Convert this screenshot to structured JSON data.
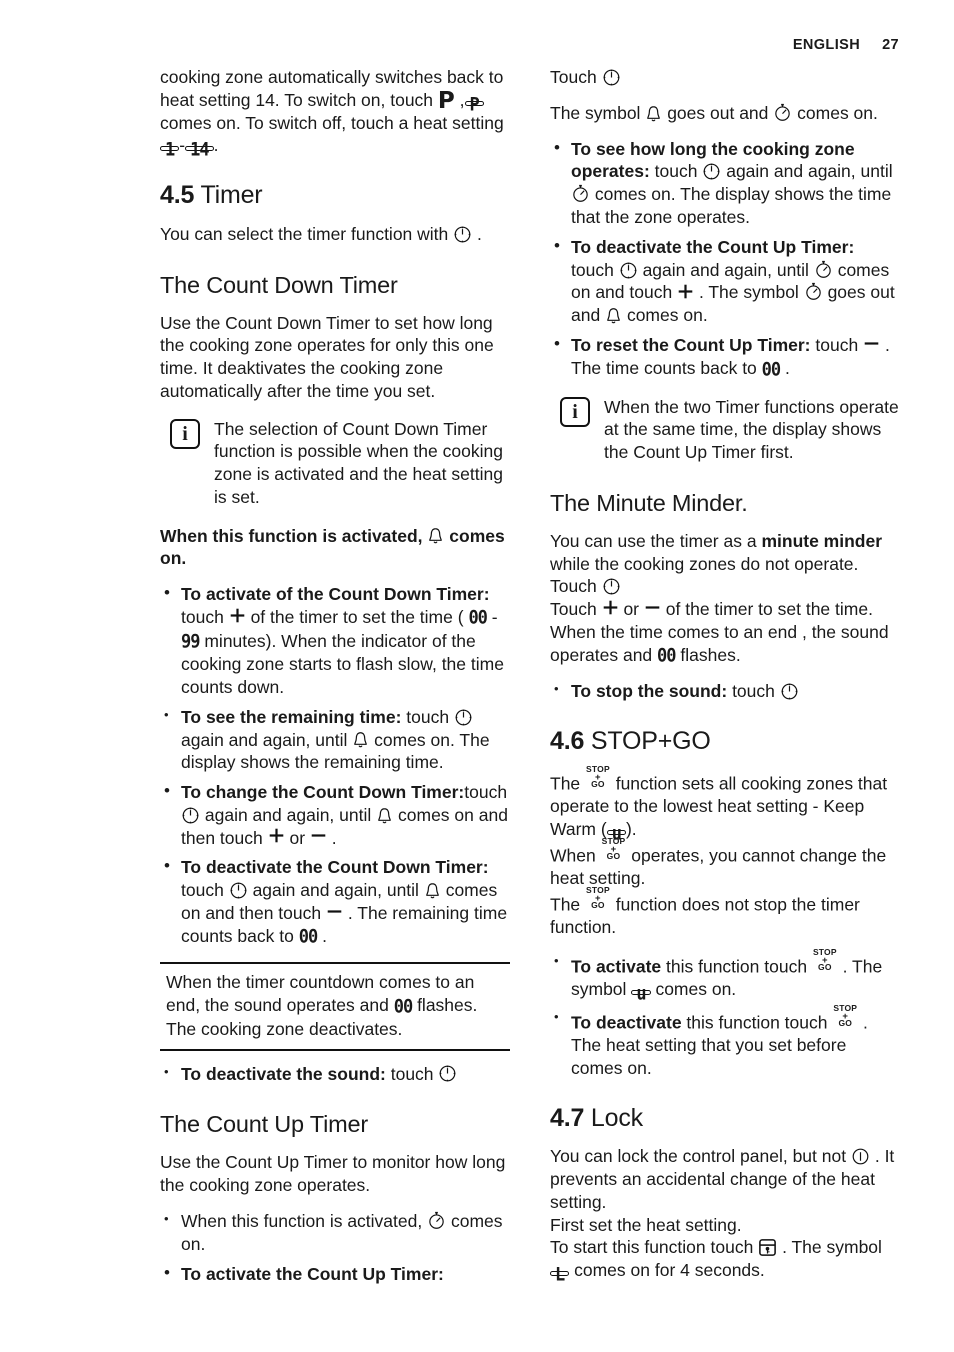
{
  "header": {
    "language": "ENGLISH",
    "page_number": "27"
  },
  "icons": {
    "timer": "timer-clock-icon",
    "bell": "bell-icon",
    "stopwatch": "stopwatch-icon",
    "info": "info-icon",
    "plus": "plus-icon",
    "minus": "minus-icon",
    "lock_key": "lock-key-icon",
    "stopgo": "stop-go-icon"
  },
  "left_column": {
    "continued_paragraph": {
      "part1": "cooking zone automatically switches back to heat setting 14. To switch on, touch",
      "part2": ",",
      "lcd_p": "P",
      "part3": "comes on. To switch off, touch a heat setting",
      "lcd_1": "1",
      "dash": "-",
      "lcd_14": "14",
      "part4": "."
    },
    "section_45": {
      "number": "4.5",
      "title": "Timer"
    },
    "intro": {
      "before": "You can select the timer function with",
      "after": "."
    },
    "count_down": {
      "heading": "The Count Down Timer",
      "body": "Use the Count Down Timer to set how long the cooking zone operates for only this one time. It deaktivates the cooking zone automatically after the time you set.",
      "note": "The selection of Count Down Timer function is possible when the cooking zone is activated and the heat setting is set.",
      "activated_line": {
        "before": "When this function is activated,",
        "after": "comes on."
      },
      "bullets": [
        {
          "lead": "To activate of the Count Down Timer:",
          "t1": "touch",
          "icon1": "plus",
          "t2": "of the timer to set the time (",
          "seg1": "00",
          "seg_sep": "-",
          "seg2": "99",
          "t3": "minutes). When the indicator of the cooking zone starts to flash slow, the time counts down."
        },
        {
          "lead": "To see the remaining time:",
          "t1": "touch",
          "icon1": "timer",
          "t2": "again and again, until",
          "icon2": "bell",
          "t3": "comes on. The display shows the remaining time."
        },
        {
          "lead": "To change the Count Down Timer:",
          "t1": "touch",
          "icon1": "timer",
          "t2": "again and again, until",
          "icon2": "bell",
          "t3": "comes on and then touch",
          "icon3": "plus",
          "t4": "or",
          "icon4": "minus",
          "t5": "."
        },
        {
          "lead": "To deactivate the Count Down Timer:",
          "t1": "touch",
          "icon1": "timer",
          "t2": "again and again, until",
          "icon2": "bell",
          "t3": "comes on and then touch",
          "icon3": "minus",
          "t4": ". The remaining time counts back to",
          "seg1": "00",
          "t5": "."
        }
      ],
      "attention": {
        "part1": "When the timer countdown comes to an end, the sound operates and",
        "seg": "00",
        "part2": "flashes. The cooking zone deactivates."
      },
      "deactivate_sound": {
        "lead": "To deactivate the sound:",
        "text": "touch"
      }
    },
    "count_up": {
      "heading": "The Count Up Timer",
      "body": "Use the Count Up Timer to monitor how long the cooking zone operates.",
      "bullets": [
        {
          "lead": "",
          "t1": "When this function is activated,",
          "icon1": "stopwatch",
          "t2": "comes on."
        },
        {
          "lead": "To activate the Count Up Timer:",
          "t1": "",
          "t2": ""
        }
      ]
    }
  },
  "right_column": {
    "count_up_continued": {
      "touch_line": "Touch",
      "symbol_line": {
        "before": "The symbol",
        "mid": "goes out and",
        "after": "comes on."
      },
      "bullets": [
        {
          "lead": "To see how long the cooking zone operates:",
          "t1": "touch",
          "icon1": "timer",
          "t2": "again and again, until",
          "icon2": "stopwatch",
          "t3": "comes on. The display shows the time that the zone operates."
        },
        {
          "lead": "To deactivate the Count Up Timer:",
          "t1": "touch",
          "icon1": "timer",
          "t2": "again and again, until",
          "icon2": "stopwatch",
          "t3": "comes on and touch",
          "icon3": "plus",
          "t4": ". The symbol",
          "icon4": "stopwatch",
          "t5": "goes out and",
          "icon5": "bell",
          "t6": "comes on."
        },
        {
          "lead": "To reset the Count Up Timer:",
          "t1": "touch",
          "icon1": "minus",
          "t2": ". The time counts back to",
          "seg1": "00",
          "t3": "."
        }
      ],
      "note": "When the two Timer functions operate at the same time, the display shows the Count Up Timer first."
    },
    "minute_minder": {
      "heading": "The Minute Minder.",
      "p1": {
        "a": "You can use the timer as a",
        "b": "minute minder",
        "c": "while the cooking zones do not operate. Touch"
      },
      "p2": {
        "a": "Touch",
        "b": "or",
        "c": "of the timer to set the time. When the time comes to an end ,",
        "d": "the sound operates and",
        "seg": "00",
        "e": "flashes."
      },
      "stop_sound": {
        "lead": "To stop the sound:",
        "text": "touch"
      }
    },
    "section_46": {
      "number": "4.6",
      "title": "STOP+GO",
      "p1": {
        "a": "The",
        "b": "function sets all cooking zones that operate to the lowest heat setting - Keep Warm (",
        "lcd": "u",
        "c": ")."
      },
      "p2": {
        "a": "When",
        "b": "operates, you cannot change the heat setting."
      },
      "p3": {
        "a": "The",
        "b": "function does not stop the timer function."
      },
      "bullets": [
        {
          "lead": "To activate",
          "t1": "this function touch",
          "t2": ".",
          "t3": "The symbol",
          "lcd": "u",
          "t4": "comes on."
        },
        {
          "lead": "To deactivate",
          "t1": "this function touch",
          "t2": ".",
          "t3": "The heat setting that you set before comes on."
        }
      ]
    },
    "section_47": {
      "number": "4.7",
      "title": "Lock",
      "p1": {
        "a": "You can lock the control panel, but not",
        "b": ". It prevents an accidental change of the heat setting."
      },
      "p2": "First set the heat setting.",
      "p3": {
        "a": "To start this function touch",
        "b": ". The symbol",
        "lcd": "L",
        "c": "comes on for 4 seconds."
      }
    }
  }
}
